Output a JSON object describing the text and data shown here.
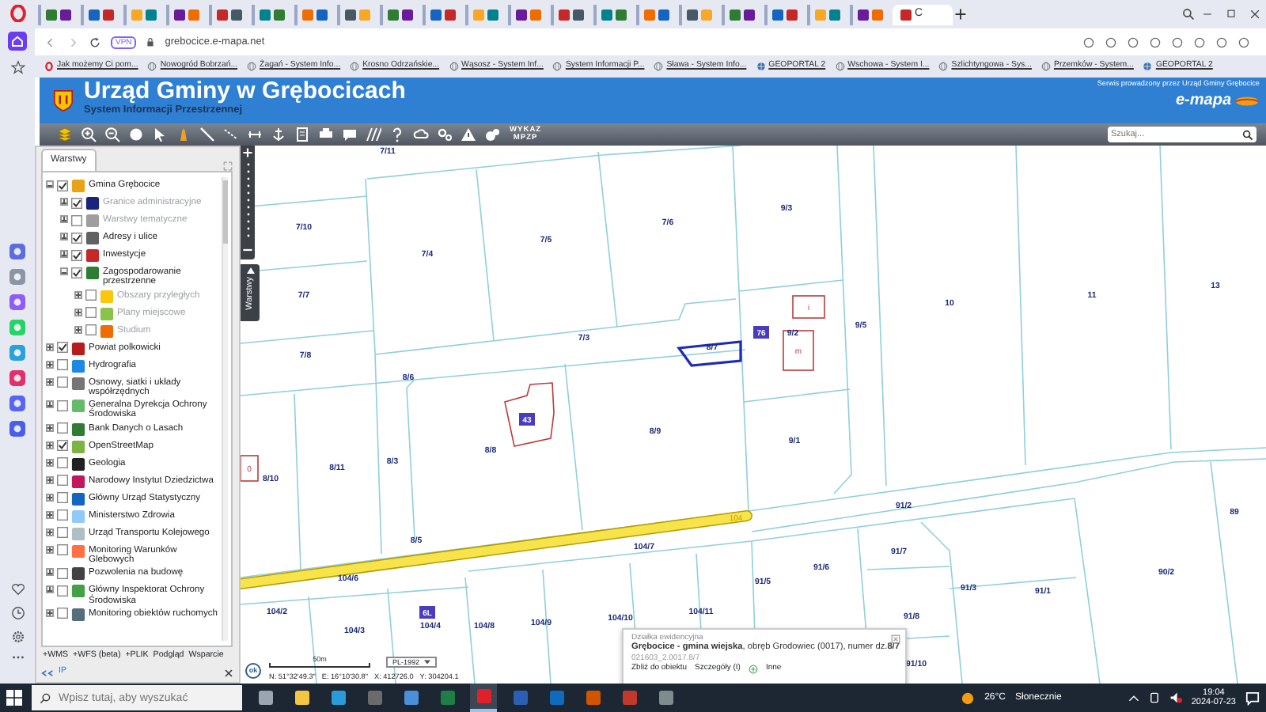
{
  "browser": {
    "tabs": [
      {
        "selected": false
      },
      {
        "selected": false
      },
      {
        "selected": false
      },
      {
        "selected": false
      },
      {
        "selected": false
      },
      {
        "selected": false
      },
      {
        "selected": false
      },
      {
        "selected": false
      },
      {
        "selected": false
      },
      {
        "selected": false
      },
      {
        "selected": false
      },
      {
        "selected": false
      },
      {
        "selected": false
      },
      {
        "selected": false
      },
      {
        "selected": false
      },
      {
        "selected": false
      },
      {
        "selected": false
      },
      {
        "selected": false
      },
      {
        "selected": false
      },
      {
        "selected": false
      },
      {
        "title": "C",
        "selected": true
      }
    ],
    "vpn_badge": "VPN",
    "address": "grebocice.e-mapa.net",
    "bookmarks": [
      {
        "label": "Jak możemy Ci pom...",
        "kind": "opera"
      },
      {
        "label": "Nowogród Bobrzań...",
        "kind": "globe"
      },
      {
        "label": "Żagań - System Info...",
        "kind": "globe"
      },
      {
        "label": "Krosno Odrzańskie...",
        "kind": "globe"
      },
      {
        "label": "Wąsosz - System Inf...",
        "kind": "globe"
      },
      {
        "label": "System Informacji P...",
        "kind": "globe"
      },
      {
        "label": "Sława - System Info...",
        "kind": "globe"
      },
      {
        "label": "GEOPORTAL 2",
        "kind": "geoportal"
      },
      {
        "label": "Wschowa - System I...",
        "kind": "globe"
      },
      {
        "label": "Szlichtyngowa - Sys...",
        "kind": "globe"
      },
      {
        "label": "Przemków - System...",
        "kind": "globe"
      },
      {
        "label": "GEOPORTAL 2",
        "kind": "geoportal"
      }
    ]
  },
  "header": {
    "title": "Urząd Gminy w Grębocicach",
    "subtitle": "System Informacji Przestrzennej",
    "notice": "Serwis prowadzony przez Urząd Gminy Grębocice",
    "logo": "e-mapa"
  },
  "toolbar": {
    "mpzp": [
      "WYKAZ",
      "MPZP"
    ],
    "search": {
      "placeholder": "Szukaj..."
    }
  },
  "layers_panel": {
    "tab": "Warstwy",
    "layers": [
      {
        "label": "Gmina Grębocice",
        "checked": true,
        "expanded": true,
        "disabled": false,
        "color": "#e8a317",
        "children": [
          {
            "label": "Granice administracyjne",
            "checked": true,
            "expanded": false,
            "disabled": true,
            "color": "#1a237e"
          },
          {
            "label": "Warstwy tematyczne",
            "checked": false,
            "expanded": false,
            "disabled": true,
            "color": "#9e9e9e"
          },
          {
            "label": "Adresy i ulice",
            "checked": true,
            "expanded": false,
            "disabled": false,
            "color": "#616161"
          },
          {
            "label": "Inwestycje",
            "checked": true,
            "expanded": false,
            "disabled": false,
            "color": "#c62828"
          },
          {
            "label": "Zagospodarowanie przestrzenne",
            "checked": true,
            "expanded": true,
            "disabled": false,
            "color": "#2e7d32",
            "children": [
              {
                "label": "Obszary przyległych",
                "checked": false,
                "expanded": false,
                "disabled": true,
                "color": "#f9c80e"
              },
              {
                "label": "Plany miejscowe",
                "checked": false,
                "expanded": false,
                "disabled": true,
                "color": "#8bc34a"
              },
              {
                "label": "Studium",
                "checked": false,
                "expanded": false,
                "disabled": true,
                "color": "#ef6c00"
              }
            ]
          }
        ]
      },
      {
        "label": "Powiat polkowicki",
        "checked": true,
        "expanded": false,
        "disabled": false,
        "color": "#b71c1c"
      },
      {
        "label": "Hydrografia",
        "checked": false,
        "expanded": false,
        "disabled": false,
        "color": "#1e88e5"
      },
      {
        "label": "Osnowy, siatki i układy współrzędnych",
        "checked": false,
        "expanded": false,
        "disabled": false,
        "color": "#757575"
      },
      {
        "label": "Generalna Dyrekcja Ochrony Środowiska",
        "checked": false,
        "expanded": false,
        "disabled": false,
        "color": "#66bb6a"
      },
      {
        "label": "Bank Danych o Lasach",
        "checked": false,
        "expanded": false,
        "disabled": false,
        "color": "#2e7d32"
      },
      {
        "label": "OpenStreetMap",
        "checked": true,
        "expanded": false,
        "disabled": false,
        "color": "#7cb342"
      },
      {
        "label": "Geologia",
        "checked": false,
        "expanded": false,
        "disabled": false,
        "color": "#212121"
      },
      {
        "label": "Narodowy Instytut Dziedzictwa",
        "checked": false,
        "expanded": false,
        "disabled": false,
        "color": "#c2185b"
      },
      {
        "label": "Główny Urząd Statystyczny",
        "checked": false,
        "expanded": false,
        "disabled": false,
        "color": "#1565c0"
      },
      {
        "label": "Ministerstwo Zdrowia",
        "checked": false,
        "expanded": false,
        "disabled": false,
        "color": "#90caf9"
      },
      {
        "label": "Urząd Transportu Kolejowego",
        "checked": false,
        "expanded": false,
        "disabled": false,
        "color": "#b0bec5"
      },
      {
        "label": "Monitoring Warunków Glebowych",
        "checked": false,
        "expanded": false,
        "disabled": false,
        "color": "#ff7043"
      },
      {
        "label": "Pozwolenia na budowę",
        "checked": false,
        "expanded": false,
        "disabled": false,
        "color": "#424242"
      },
      {
        "label": "Główny Inspektorat Ochrony Środowiska",
        "checked": false,
        "expanded": false,
        "disabled": false,
        "color": "#43a047"
      },
      {
        "label": "Monitoring obiektów ruchomych",
        "checked": false,
        "expanded": false,
        "disabled": false,
        "color": "#546e7a"
      }
    ],
    "links": [
      "+WMS",
      "+WFS (beta)",
      "+PLIK",
      "Podgląd",
      "Wsparcie"
    ],
    "footer": "IP"
  },
  "map": {
    "side_tab": "Warstwy",
    "parcels": [
      {
        "label": "7/11"
      },
      {
        "label": "7/10"
      },
      {
        "label": "7/4"
      },
      {
        "label": "7/5"
      },
      {
        "label": "7/6"
      },
      {
        "label": "9/3"
      },
      {
        "label": "7/7"
      },
      {
        "label": "7/3"
      },
      {
        "label": "8/7"
      },
      {
        "label": "9/2"
      },
      {
        "label": "9/5"
      },
      {
        "label": "10"
      },
      {
        "label": "11"
      },
      {
        "label": "13"
      },
      {
        "label": "7/8"
      },
      {
        "label": "8/6"
      },
      {
        "label": "8/9"
      },
      {
        "label": "9/1"
      },
      {
        "label": "8/8"
      },
      {
        "label": "8/11"
      },
      {
        "label": "8/3"
      },
      {
        "label": "8/10"
      },
      {
        "label": "91/2"
      },
      {
        "label": "89"
      },
      {
        "label": "104/7"
      },
      {
        "label": "8/5"
      },
      {
        "label": "91/7"
      },
      {
        "label": "91/6"
      },
      {
        "label": "90/2"
      },
      {
        "label": "104/6"
      },
      {
        "label": "91/5"
      },
      {
        "label": "91/3"
      },
      {
        "label": "91/1"
      },
      {
        "label": "104/2"
      },
      {
        "label": "104/3"
      },
      {
        "label": "104/4"
      },
      {
        "label": "104/8"
      },
      {
        "label": "104/9"
      },
      {
        "label": "104/10"
      },
      {
        "label": "104/11"
      },
      {
        "label": "91/8"
      },
      {
        "label": "91/10"
      }
    ],
    "house_numbers": [
      "43",
      "76",
      "6L"
    ],
    "building_labels": [
      "i",
      "m",
      "0"
    ],
    "road_label": "104",
    "north_button": "ok",
    "scale": "50m",
    "crs": "PL-1992",
    "coordinates": [
      "N: 51°32'49.3\"",
      "E: 16°10'30.8\"",
      "X: 412726.0",
      "Y: 304204.1"
    ],
    "popup": {
      "heading": "Działka ewidencyjna",
      "description": "**Grębocice - gmina wiejska**, obręb Grodowiec (0017), numer dz.**8/7**",
      "id": "021603_2.0017.8/7",
      "actions": [
        "Zbliż do obiektu",
        "Szczegóły (I)",
        "Inne"
      ]
    }
  },
  "taskbar": {
    "search": {
      "placeholder": "Wpisz tutaj, aby wyszukać"
    },
    "apps": [
      {
        "selected": false
      },
      {
        "selected": false
      },
      {
        "selected": false
      },
      {
        "selected": false
      },
      {
        "selected": false
      },
      {
        "selected": false
      },
      {
        "selected": true
      },
      {
        "selected": false
      },
      {
        "selected": false
      },
      {
        "selected": false
      },
      {
        "selected": false
      },
      {
        "selected": false
      }
    ],
    "temperature": "26°C",
    "weather": "Słonecznie",
    "time": "19:04",
    "date": "2024-07-23"
  }
}
